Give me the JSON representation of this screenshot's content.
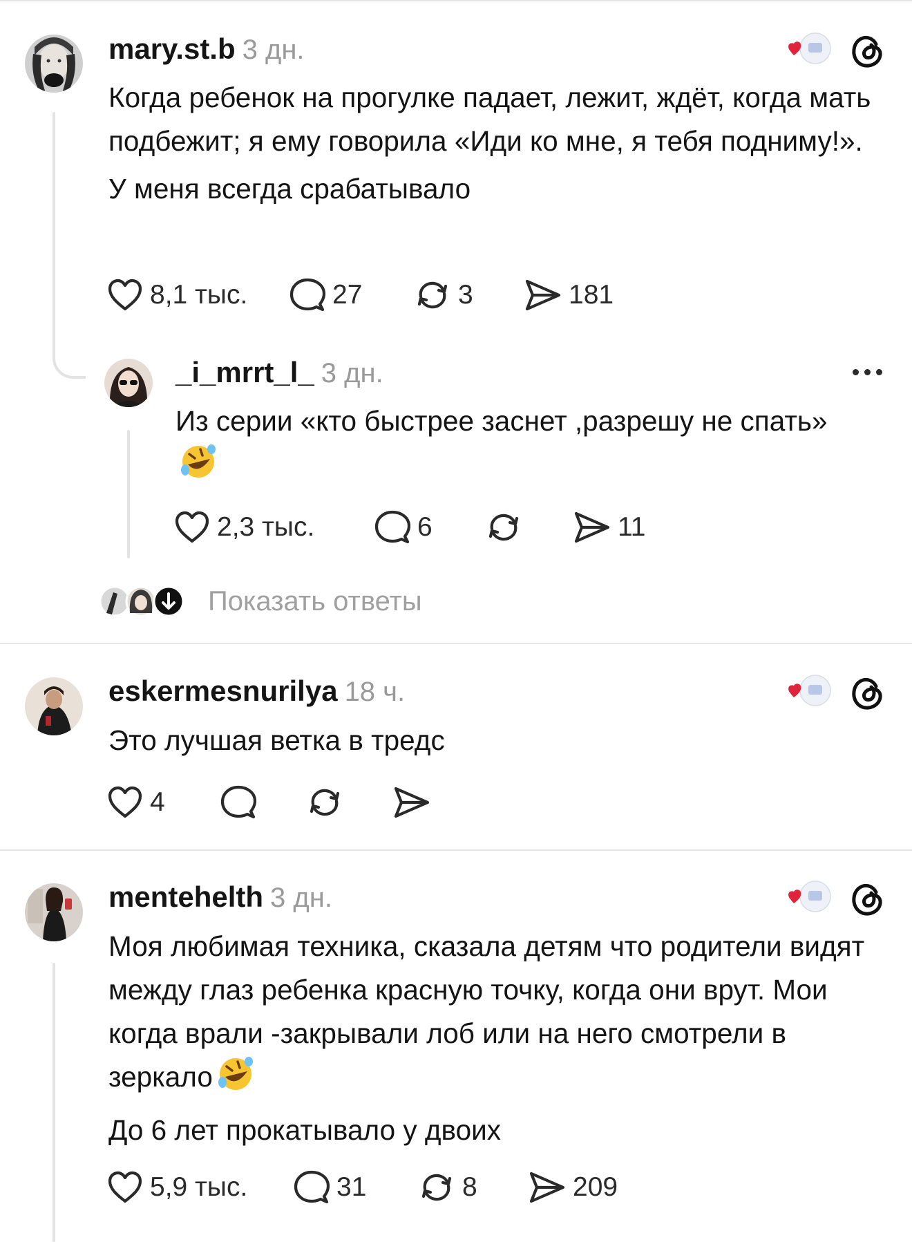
{
  "comments": [
    {
      "username": "mary.st.b",
      "time": "3 дн.",
      "text": [
        "Когда ребенок на прогулке падает, лежит, ждёт, когда мать подбежит; я ему говорила «Иди ко мне, я тебя подниму!».",
        "У меня всегда срабатывало"
      ],
      "likes": "8,1 тыс.",
      "replies": "27",
      "reposts": "3",
      "shares": "181"
    },
    {
      "username": "_i_mrrt_l_",
      "time": "3 дн.",
      "text": [
        "Из серии «кто быстрее заснет ,разрешу не спать»"
      ],
      "likes": "2,3 тыс.",
      "replies": "6",
      "reposts": "",
      "shares": "11"
    },
    {
      "username": "eskermesnurilya",
      "time": "18 ч.",
      "text": [
        "Это лучшая ветка в тредс"
      ],
      "likes": "4",
      "replies": "",
      "reposts": "",
      "shares": ""
    },
    {
      "username": "mentehelth",
      "time": "3 дн.",
      "text": [
        "Моя любимая техника, сказала детям что родители видят между глаз ребенка красную точку, когда они врут. Мои когда врали -закрывали лоб или на него смотрели в зеркало",
        "До 6 лет прокатывало у двоих"
      ],
      "likes": "5,9 тыс.",
      "replies": "31",
      "reposts": "8",
      "shares": "209"
    }
  ],
  "show_replies_label": "Показать ответы",
  "icons": {
    "like": "heart-icon",
    "reply": "comment-icon",
    "repost": "repost-icon",
    "share": "send-icon",
    "threads": "threads-logo-icon",
    "more": "more-icon",
    "emoji": "rolling-laughing-emoji"
  },
  "colors": {
    "heart_badge": "#e0243b",
    "meta_gray": "#9a9a9a",
    "divider": "#e6e6e6"
  }
}
